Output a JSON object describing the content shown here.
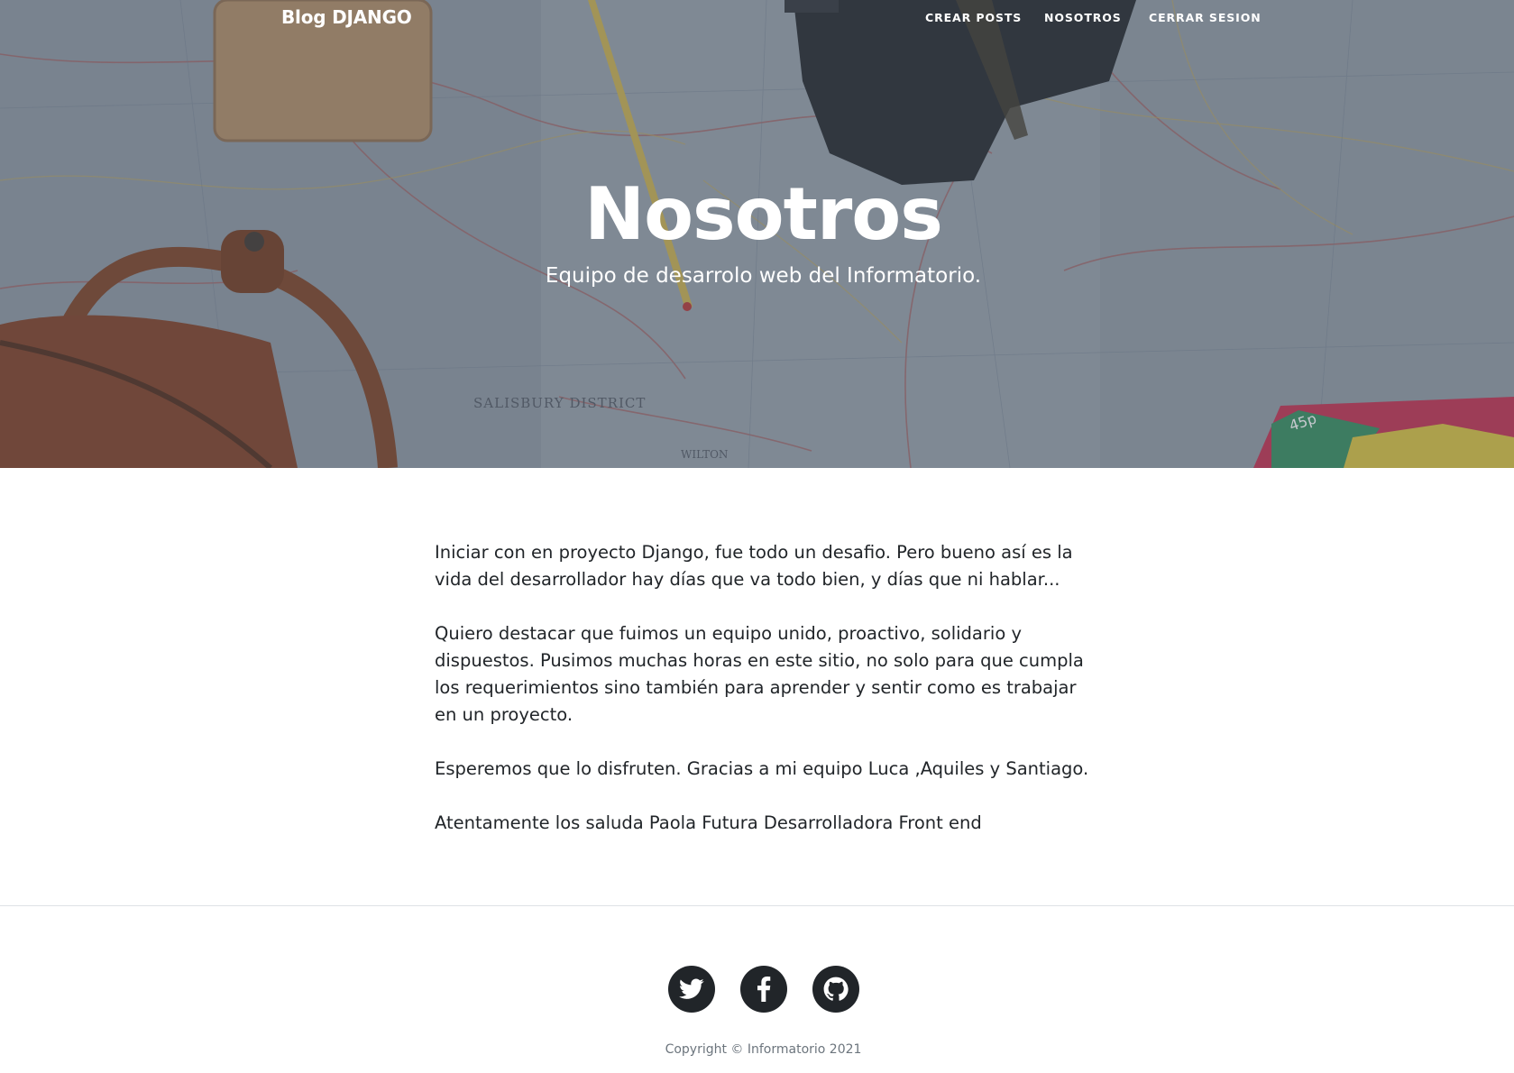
{
  "navbar": {
    "brand": "Blog DJANGO",
    "links": [
      "CREAR POSTS",
      "NOSOTROS",
      "CERRAR SESION"
    ]
  },
  "hero": {
    "title": "Nosotros",
    "subtitle": "Equipo de desarrolo web del Informatorio.",
    "map_labels": [
      "SALISBURY DISTRICT",
      "WILTON",
      "45p"
    ]
  },
  "content": {
    "paragraphs": [
      "Iniciar con en proyecto Django, fue todo un desafio. Pero bueno así es la vida del desarrollador hay días que va todo bien, y días que ni hablar...",
      "Quiero destacar que fuimos un equipo unido, proactivo, solidario y dispuestos. Pusimos muchas horas en este sitio, no solo para que cumpla los requerimientos sino también para aprender y sentir como es trabajar en un proyecto.",
      "Esperemos que lo disfruten. Gracias a mi equipo Luca ,Aquiles y Santiago.",
      "Atentamente los saluda Paola Futura Desarrolladora Front end"
    ]
  },
  "footer": {
    "social_icons": [
      "twitter-icon",
      "facebook-icon",
      "github-icon"
    ],
    "copyright": "Copyright © Informatorio 2021"
  },
  "colors": {
    "dark": "#212529",
    "muted": "#6c757d",
    "overlay": "#5a6270"
  }
}
